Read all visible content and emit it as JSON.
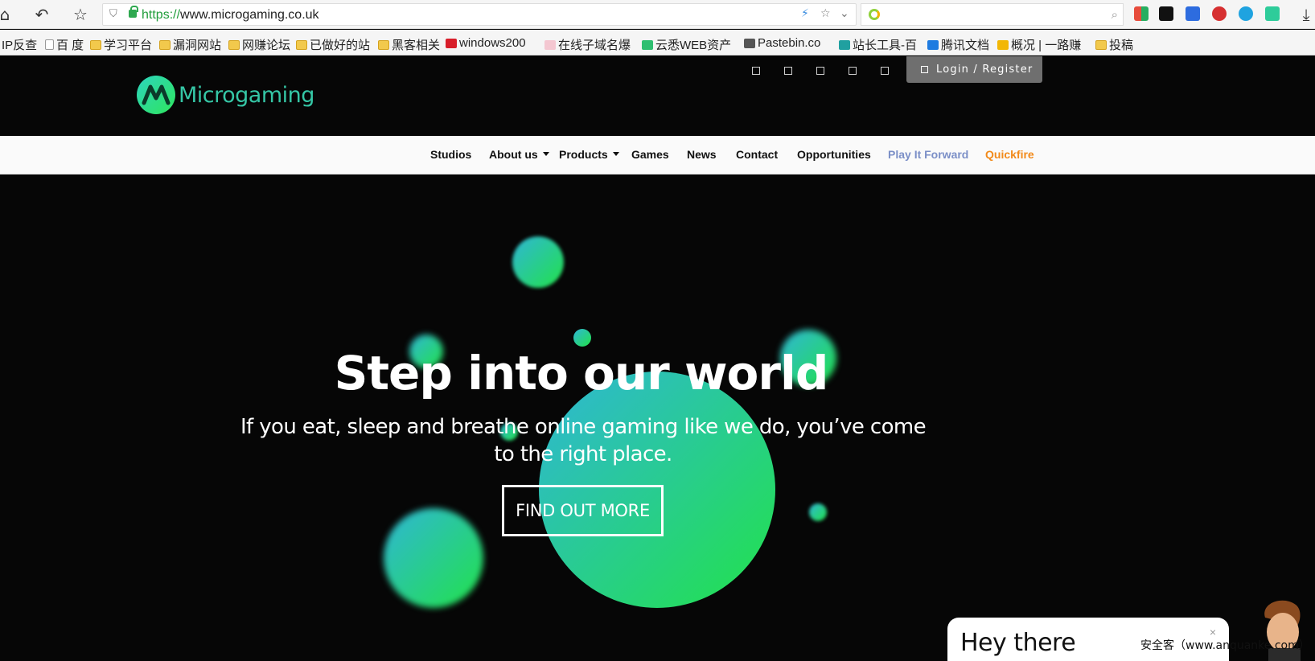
{
  "browser": {
    "url_scheme": "https://",
    "url_host": "www.microgaming.co.uk",
    "icons": [
      "home-icon",
      "undo-icon",
      "star-icon",
      "shield-icon",
      "lock-icon",
      "lightning-icon",
      "bookmark-star-icon",
      "chevron-down-icon",
      "search-icon",
      "download-icon"
    ]
  },
  "bookmarks": [
    {
      "label": "IP反查",
      "icon": "none"
    },
    {
      "label": "百 度",
      "icon": "page"
    },
    {
      "label": "学习平台",
      "icon": "folder"
    },
    {
      "label": "漏洞网站",
      "icon": "folder"
    },
    {
      "label": "网赚论坛",
      "icon": "folder"
    },
    {
      "label": "已做好的站",
      "icon": "folder"
    },
    {
      "label": "黑客相关",
      "icon": "folder"
    },
    {
      "label": "windows200",
      "icon": "red-c"
    },
    {
      "label": "在线子域名爆",
      "icon": "cat"
    },
    {
      "label": "云悉WEB资产",
      "icon": "green"
    },
    {
      "label": "Pastebin.co",
      "icon": "paste"
    },
    {
      "label": "站长工具-百",
      "icon": "teal"
    },
    {
      "label": "腾讯文档",
      "icon": "blue"
    },
    {
      "label": "概况 | 一路赚",
      "icon": "yellow"
    },
    {
      "label": "投稿",
      "icon": "folder"
    }
  ],
  "site": {
    "logo_text": "Microgaming",
    "login_label": "Login / Register",
    "nav": [
      {
        "label": "Studios",
        "dropdown": false
      },
      {
        "label": "About us",
        "dropdown": true
      },
      {
        "label": "Products",
        "dropdown": true
      },
      {
        "label": "Games",
        "dropdown": false
      },
      {
        "label": "News",
        "dropdown": false
      },
      {
        "label": "Contact",
        "dropdown": false
      },
      {
        "label": "Opportunities",
        "dropdown": false
      },
      {
        "label": "Play It Forward",
        "dropdown": false
      },
      {
        "label": "Quickfire",
        "dropdown": false
      }
    ],
    "colors": {
      "play_it_forward": "#7b8fc7",
      "quickfire": "#f28a1a",
      "bubble_start": "#2fb6d6",
      "bubble_end": "#22e24a"
    }
  },
  "hero": {
    "title": "Step into our world",
    "subtitle": "If you eat, sleep and breathe online gaming like we do, you’ve come to the right place.",
    "cta_label": "FIND OUT MORE"
  },
  "chat": {
    "title": "Hey there",
    "close": "×"
  },
  "watermark": "安全客（www.anquanke.com）"
}
